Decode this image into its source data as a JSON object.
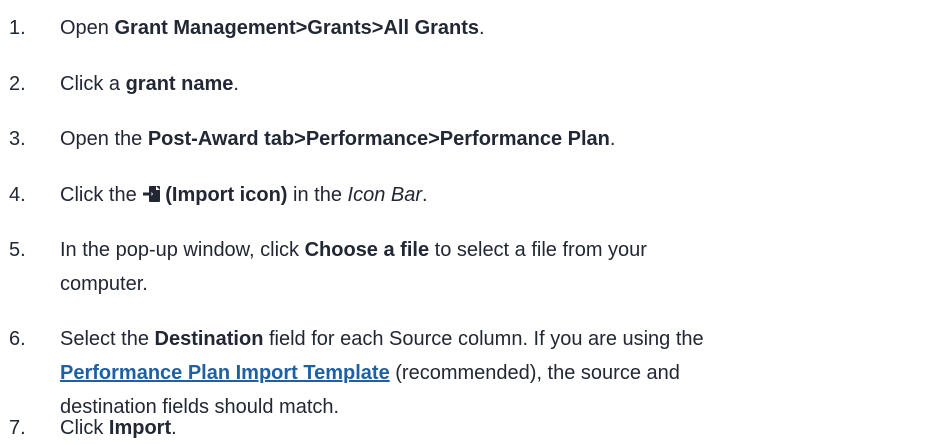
{
  "steps": [
    {
      "number": "1.",
      "pre": "Open ",
      "bold": "Grant Management>Grants>All Grants",
      "post": "."
    },
    {
      "number": "2.",
      "pre": "Click a ",
      "bold": "grant name",
      "post": "."
    },
    {
      "number": "3.",
      "pre": "Open the ",
      "bold": "Post-Award tab>Performance>Performance Plan",
      "post": "."
    },
    {
      "number": "4.",
      "pre": "Click the ",
      "icon": "import-icon",
      "bold": "(Import icon)",
      "mid": " in the ",
      "italic": "Icon Bar",
      "post": "."
    },
    {
      "number": "5.",
      "pre": "In the pop-up window, click ",
      "bold": "Choose a file",
      "post": " to select a file from your computer."
    },
    {
      "number": "6.",
      "pre": "Select the ",
      "bold": "Destination",
      "mid1": " field for each Source column. If you are using the ",
      "link": "Performance Plan Import Template",
      "post": " (recommended), the source and destination fields should match."
    },
    {
      "number": "7.",
      "pre": "Click ",
      "bold": "Import",
      "post": "."
    }
  ],
  "colors": {
    "text": "#222734",
    "link": "#1f5fa3"
  }
}
